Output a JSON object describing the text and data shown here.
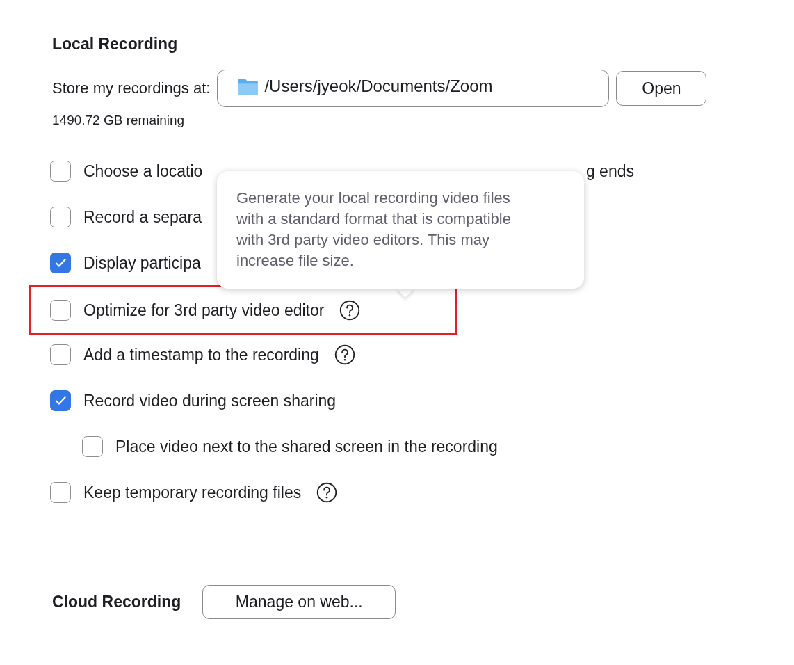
{
  "local_recording": {
    "title": "Local Recording",
    "store_label": "Store my recordings at:",
    "path": "/Users/jyeok/Documents/Zoom",
    "open_button": "Open",
    "remaining": "1490.72 GB remaining",
    "options": [
      {
        "label": "Choose a locatio",
        "tail": "g ends",
        "checked": false,
        "help": false,
        "highlighted": false
      },
      {
        "label": "Record a separa",
        "checked": false,
        "help": false,
        "highlighted": false
      },
      {
        "label": "Display participa",
        "checked": true,
        "help": false,
        "highlighted": false
      },
      {
        "label": "Optimize for 3rd party video editor",
        "checked": false,
        "help": true,
        "highlighted": true
      },
      {
        "label": "Add a timestamp to the recording",
        "checked": false,
        "help": true,
        "highlighted": false
      },
      {
        "label": "Record video during screen sharing",
        "checked": true,
        "help": false,
        "highlighted": false,
        "children": [
          {
            "label": "Place video next to the shared screen in the recording",
            "checked": false,
            "help": false,
            "highlighted": false
          }
        ]
      },
      {
        "label": "Keep temporary recording files",
        "checked": false,
        "help": true,
        "highlighted": false
      }
    ],
    "tooltip": "Generate your local recording video files with a standard format that is compatible with 3rd party video editors. This may increase file size."
  },
  "cloud_recording": {
    "title": "Cloud Recording",
    "manage_button": "Manage on web..."
  }
}
